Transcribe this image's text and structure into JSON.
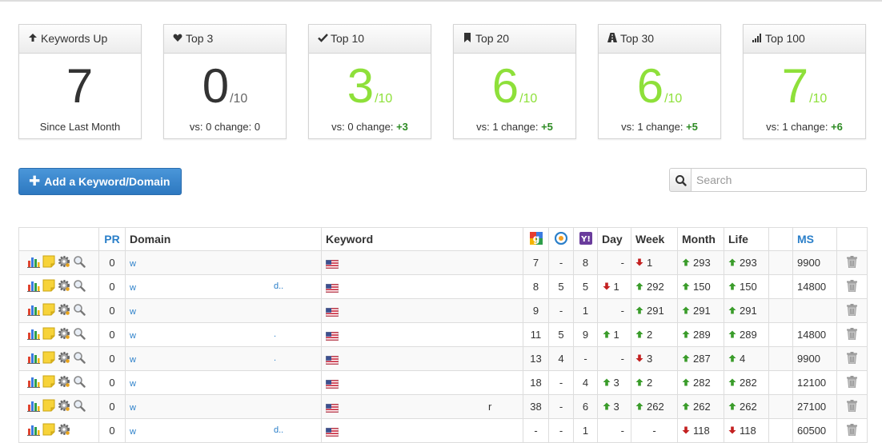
{
  "cards": [
    {
      "icon": "arrow-up-icon",
      "title": "Keywords Up",
      "value": "7",
      "outof": "",
      "foot_text": "Since Last Month",
      "change": "",
      "green": false
    },
    {
      "icon": "heart-icon",
      "title": "Top 3",
      "value": "0",
      "outof": "/10",
      "foot_text": "vs: 0 change: 0",
      "change": "",
      "green": false
    },
    {
      "icon": "check-icon",
      "title": "Top 10",
      "value": "3",
      "outof": "/10",
      "foot_text": "vs: 0 change: ",
      "change": "+3",
      "green": true
    },
    {
      "icon": "bookmark-icon",
      "title": "Top 20",
      "value": "6",
      "outof": "/10",
      "foot_text": "vs: 1 change: ",
      "change": "+5",
      "green": true
    },
    {
      "icon": "road-icon",
      "title": "Top 30",
      "value": "6",
      "outof": "/10",
      "foot_text": "vs: 1 change: ",
      "change": "+5",
      "green": true
    },
    {
      "icon": "signal-icon",
      "title": "Top 100",
      "value": "7",
      "outof": "/10",
      "foot_text": "vs: 1 change: ",
      "change": "+6",
      "green": true
    }
  ],
  "add_button": {
    "label": "Add a Keyword/Domain"
  },
  "search": {
    "placeholder": "Search"
  },
  "table": {
    "headers": {
      "pr": "PR",
      "domain": "Domain",
      "keyword": "Keyword",
      "day": "Day",
      "week": "Week",
      "month": "Month",
      "life": "Life",
      "ms": "MS"
    },
    "rows": [
      {
        "pr": "0",
        "domain": "w",
        "keyword": "",
        "google": "7",
        "bing": "-",
        "yahoo": "8",
        "day": {
          "v": "-",
          "d": ""
        },
        "week": {
          "v": "1",
          "d": "down"
        },
        "month": {
          "v": "293",
          "d": "up"
        },
        "life": {
          "v": "293",
          "d": "up"
        },
        "ms": "9900",
        "search_tool": true
      },
      {
        "pr": "0",
        "domain": "w",
        "domain_end": "d..",
        "keyword": "",
        "google": "8",
        "bing": "5",
        "yahoo": "5",
        "day": {
          "v": "1",
          "d": "down"
        },
        "week": {
          "v": "292",
          "d": "up"
        },
        "month": {
          "v": "150",
          "d": "up"
        },
        "life": {
          "v": "150",
          "d": "up"
        },
        "ms": "14800",
        "search_tool": true
      },
      {
        "pr": "0",
        "domain": "w",
        "keyword": "",
        "google": "9",
        "bing": "-",
        "yahoo": "1",
        "day": {
          "v": "-",
          "d": ""
        },
        "week": {
          "v": "291",
          "d": "up"
        },
        "month": {
          "v": "291",
          "d": "up"
        },
        "life": {
          "v": "291",
          "d": "up"
        },
        "ms": "",
        "search_tool": true
      },
      {
        "pr": "0",
        "domain": "w",
        "domain_end": ".",
        "keyword": "",
        "google": "11",
        "bing": "5",
        "yahoo": "9",
        "day": {
          "v": "1",
          "d": "up"
        },
        "week": {
          "v": "2",
          "d": "up"
        },
        "month": {
          "v": "289",
          "d": "up"
        },
        "life": {
          "v": "289",
          "d": "up"
        },
        "ms": "14800",
        "search_tool": true
      },
      {
        "pr": "0",
        "domain": "w",
        "domain_end": ".",
        "keyword": "",
        "google": "13",
        "bing": "4",
        "yahoo": "-",
        "day": {
          "v": "-",
          "d": ""
        },
        "week": {
          "v": "3",
          "d": "down"
        },
        "month": {
          "v": "287",
          "d": "up"
        },
        "life": {
          "v": "4",
          "d": "up"
        },
        "ms": "9900",
        "search_tool": true
      },
      {
        "pr": "0",
        "domain": "w",
        "keyword": "",
        "google": "18",
        "bing": "-",
        "yahoo": "4",
        "day": {
          "v": "3",
          "d": "up"
        },
        "week": {
          "v": "2",
          "d": "up"
        },
        "month": {
          "v": "282",
          "d": "up"
        },
        "life": {
          "v": "282",
          "d": "up"
        },
        "ms": "12100",
        "search_tool": true
      },
      {
        "pr": "0",
        "domain": "w",
        "keyword": "r",
        "google": "38",
        "bing": "-",
        "yahoo": "6",
        "day": {
          "v": "3",
          "d": "up"
        },
        "week": {
          "v": "262",
          "d": "up"
        },
        "month": {
          "v": "262",
          "d": "up"
        },
        "life": {
          "v": "262",
          "d": "up"
        },
        "ms": "27100",
        "search_tool": true
      },
      {
        "pr": "0",
        "domain": "w",
        "domain_end": "d..",
        "keyword": "",
        "google": "-",
        "bing": "-",
        "yahoo": "1",
        "day": {
          "v": "-",
          "d": ""
        },
        "week": {
          "v": "-",
          "d": ""
        },
        "month": {
          "v": "118",
          "d": "down"
        },
        "life": {
          "v": "118",
          "d": "down"
        },
        "ms": "60500",
        "search_tool": false
      }
    ]
  },
  "colors": {
    "accent_blue": "#2a7fc9",
    "green_big": "#8ee03a",
    "change_green": "#2c8a22",
    "up_arrow": "#3a9c2a",
    "down_arrow": "#c32020"
  }
}
